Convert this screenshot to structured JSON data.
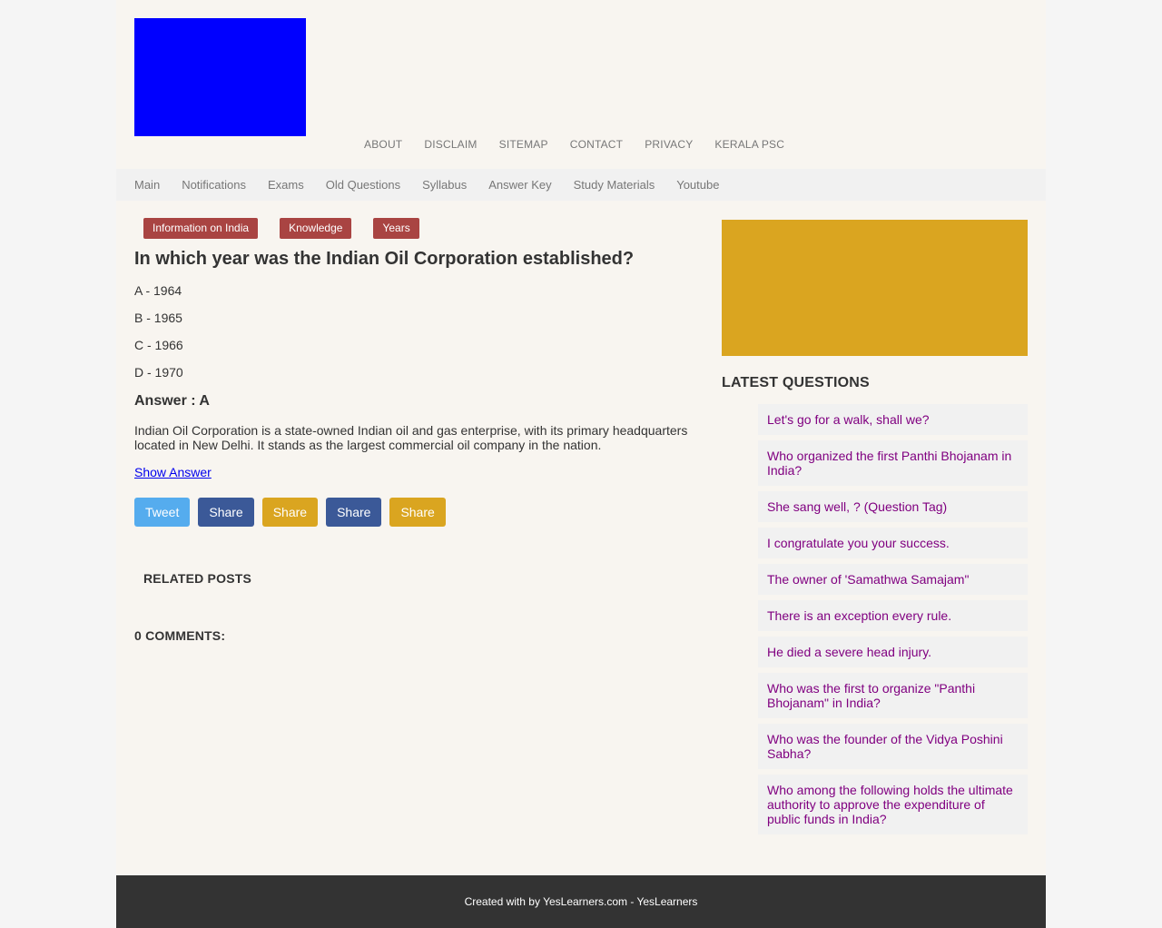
{
  "top_nav": [
    "ABOUT",
    "DISCLAIM",
    "SITEMAP",
    "CONTACT",
    "PRIVACY",
    "KERALA PSC"
  ],
  "main_nav": [
    "Main",
    "Notifications",
    "Exams",
    "Old Questions",
    "Syllabus",
    "Answer Key",
    "Study Materials",
    "Youtube"
  ],
  "post": {
    "labels": [
      "Information on India",
      "Knowledge",
      "Years"
    ],
    "title": "In which year was the Indian Oil Corporation established?",
    "options": [
      "A - 1964",
      "B - 1965",
      "C - 1966",
      "D - 1970"
    ],
    "answer": "Answer : A",
    "explanation": "Indian Oil Corporation is a state-owned Indian oil and gas enterprise, with its primary headquarters located in New Delhi. It stands as the largest commercial oil company in the nation.",
    "show_answer": "Show Answer",
    "share_buttons": [
      {
        "label": "Tweet",
        "color": "#55acee"
      },
      {
        "label": "Share",
        "color": "#3b5998"
      },
      {
        "label": "Share",
        "color": "#daa520"
      },
      {
        "label": "Share",
        "color": "#3b5998"
      },
      {
        "label": "Share",
        "color": "#daa520"
      }
    ],
    "related_heading": "RELATED POSTS",
    "comments_heading": "0 COMMENTS:"
  },
  "sidebar": {
    "latest_heading": "LATEST QUESTIONS",
    "latest_questions": [
      "Let's go for a walk, shall we?",
      "Who organized the first Panthi Bhojanam in India?",
      "She sang well, ? (Question Tag)",
      "I congratulate you your success.",
      "The owner of 'Samathwa Samajam\"",
      "There is an exception every rule.",
      "He died a severe head injury.",
      "Who was the first to organize \"Panthi Bhojanam\" in India?",
      "Who was the founder of the Vidya Poshini Sabha?",
      "Who among the following holds the ultimate authority to approve the expenditure of public funds in India?"
    ]
  },
  "footer": {
    "text": "Created with by YesLearners.com - YesLearners"
  },
  "colors": {
    "logo": "#0000ff",
    "ad_block": "#daa520",
    "label_bg": "#a94442",
    "link_purple": "#800080",
    "footer_bg": "#333333"
  }
}
